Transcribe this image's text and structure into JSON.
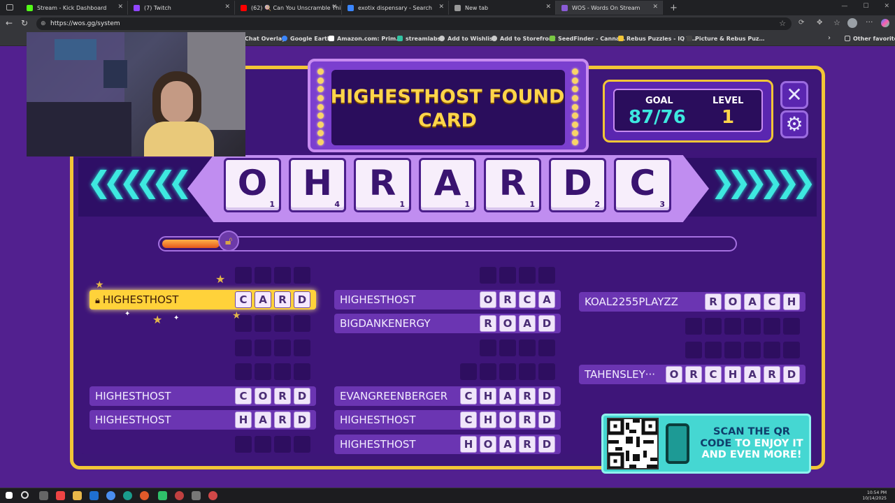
{
  "browser": {
    "tabs": [
      {
        "title": "Stream - Kick Dashboard",
        "color": "#53fc18"
      },
      {
        "title": "(7) Twitch",
        "color": "#9146ff"
      },
      {
        "title": "(62) 🍭 Can You Unscramble Thi…",
        "color": "#ff0000"
      },
      {
        "title": "exotix dispensary - Search",
        "color": "#3a86ff"
      },
      {
        "title": "New tab",
        "color": "#999999"
      },
      {
        "title": "WOS - Words On Stream",
        "color": "#8a5bd6"
      }
    ],
    "url": "https://wos.gg/system",
    "bookmarks": [
      "Chat Overlay",
      "Google Earth",
      "Amazon.com: Prim…",
      "streamlabs",
      "Add to Wishlist",
      "Add to Storefront",
      "SeedFinder - Canna…",
      "Rebus Puzzles - IQ T…",
      "Picture & Rebus Puz…"
    ],
    "other_favorites": "Other favorites"
  },
  "game": {
    "title_line1": "HIGHESTHOST FOUND",
    "title_line2": "CARD",
    "goal_label": "GOAL",
    "goal_value": "87/76",
    "level_label": "LEVEL",
    "level_value": "1",
    "progress": 0.1,
    "tiles": [
      {
        "letter": "O",
        "num": "1"
      },
      {
        "letter": "H",
        "num": "4"
      },
      {
        "letter": "R",
        "num": "1"
      },
      {
        "letter": "A",
        "num": "1"
      },
      {
        "letter": "R",
        "num": "1"
      },
      {
        "letter": "D",
        "num": "2"
      },
      {
        "letter": "C",
        "num": "3"
      }
    ],
    "col1": [
      {
        "name": "",
        "letters": [
          "",
          "",
          "",
          ""
        ]
      },
      {
        "name": "HIGHESTHOST",
        "letters": [
          "C",
          "A",
          "R",
          "D"
        ]
      },
      {
        "name": "",
        "letters": [
          "",
          "",
          "",
          ""
        ]
      },
      {
        "name": "",
        "letters": [
          "",
          "",
          "",
          ""
        ]
      },
      {
        "name": "",
        "letters": [
          "",
          "",
          "",
          ""
        ]
      },
      {
        "name": "HIGHESTHOST",
        "letters": [
          "C",
          "O",
          "R",
          "D"
        ]
      },
      {
        "name": "HIGHESTHOST",
        "letters": [
          "H",
          "A",
          "R",
          "D"
        ]
      },
      {
        "name": "",
        "letters": [
          "",
          "",
          "",
          ""
        ]
      }
    ],
    "col2": [
      {
        "name": "",
        "letters": [
          "",
          "",
          "",
          ""
        ]
      },
      {
        "name": "HIGHESTHOST",
        "letters": [
          "O",
          "R",
          "C",
          "A"
        ]
      },
      {
        "name": "BIGDANKENERGY",
        "letters": [
          "R",
          "O",
          "A",
          "D"
        ]
      },
      {
        "name": "",
        "letters": [
          "",
          "",
          "",
          ""
        ]
      },
      {
        "name": "",
        "letters": [
          "",
          "",
          "",
          "",
          ""
        ]
      },
      {
        "name": "EVANGREENBERGER",
        "letters": [
          "C",
          "H",
          "A",
          "R",
          "D"
        ]
      },
      {
        "name": "HIGHESTHOST",
        "letters": [
          "C",
          "H",
          "O",
          "R",
          "D"
        ]
      },
      {
        "name": "HIGHESTHOST",
        "letters": [
          "H",
          "O",
          "A",
          "R",
          "D"
        ]
      }
    ],
    "col3": [
      {
        "name": "KOAL2255PLAYZZ",
        "letters": [
          "R",
          "O",
          "A",
          "C",
          "H"
        ]
      },
      {
        "name": "",
        "letters": [
          "",
          "",
          "",
          "",
          "",
          ""
        ]
      },
      {
        "name": "",
        "letters": [
          "",
          "",
          "",
          "",
          "",
          ""
        ]
      },
      {
        "name": "TAHENSLEY···",
        "letters": [
          "O",
          "R",
          "C",
          "H",
          "A",
          "R",
          "D"
        ]
      }
    ],
    "qr_line1": "SCAN THE QR",
    "qr_line2a": "CODE ",
    "qr_line2b": "TO ENJOY IT",
    "qr_line3": "AND EVEN MORE!",
    "colors": {
      "accent": "#f2c636",
      "cyan": "#3ee8e0",
      "purple": "#52208f"
    }
  },
  "taskbar": {
    "time": "10:54 PM",
    "date": "10/14/2025"
  }
}
